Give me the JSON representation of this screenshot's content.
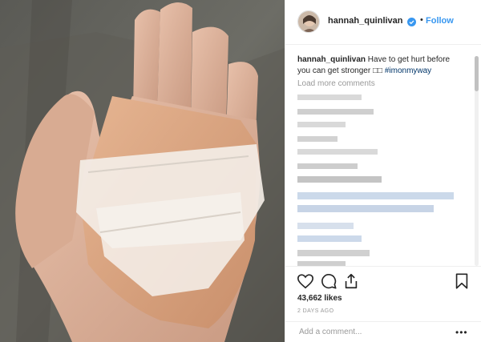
{
  "post": {
    "username": "hannah_quinlivan",
    "follow_label": "Follow",
    "dot": "•",
    "caption": {
      "user": "hannah_quinlivan",
      "text": "Have to get hurt before you can get stronger",
      "emoji_placeholder": "□□",
      "hashtag": "#imonmyway"
    },
    "load_more": "Load more comments",
    "likes": "43,662 likes",
    "time": "2 DAYS AGO",
    "add_comment_placeholder": "Add a comment...",
    "more_label": "•••"
  },
  "icons": {
    "avatar": "profile-avatar",
    "verified": "verified-badge-icon",
    "like": "heart-icon",
    "comment": "comment-icon",
    "share": "share-icon",
    "save": "bookmark-icon",
    "more": "more-options-icon"
  },
  "colors": {
    "accent": "#3897f0",
    "text": "#262626",
    "muted": "#999999",
    "hashtag": "#003569"
  }
}
